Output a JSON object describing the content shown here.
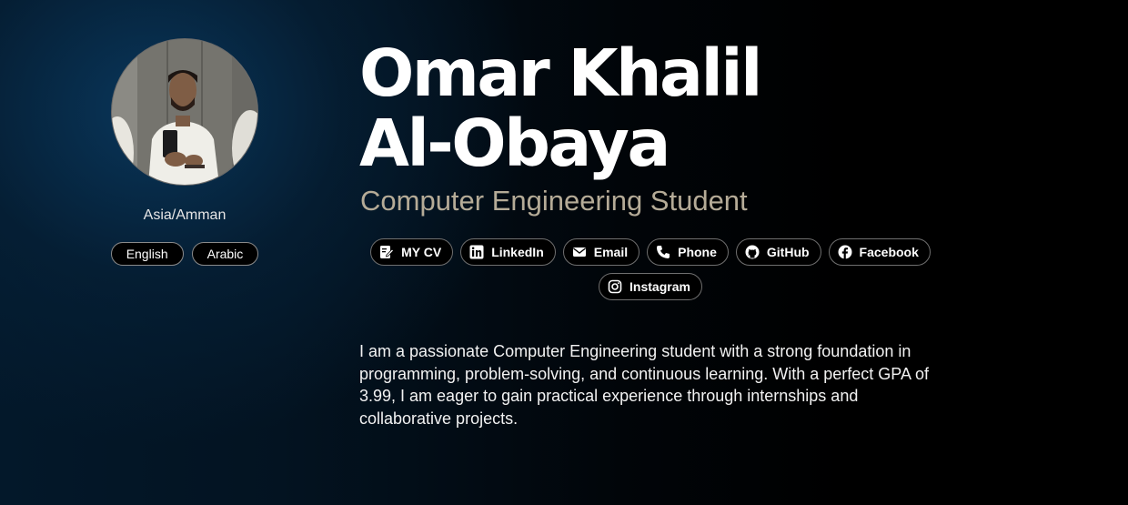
{
  "profile": {
    "name": "Omar Khalil Al-Obaya",
    "role": "Computer Engineering Student",
    "timezone": "Asia/Amman",
    "avatar_alt": "profile-photo"
  },
  "languages": [
    {
      "label": "English"
    },
    {
      "label": "Arabic"
    }
  ],
  "links": [
    {
      "label": "MY CV",
      "icon": "cv-icon"
    },
    {
      "label": "LinkedIn",
      "icon": "linkedin-icon"
    },
    {
      "label": "Email",
      "icon": "envelope-icon"
    },
    {
      "label": "Phone",
      "icon": "phone-icon"
    },
    {
      "label": "GitHub",
      "icon": "github-icon"
    },
    {
      "label": "Facebook",
      "icon": "facebook-icon"
    },
    {
      "label": "Instagram",
      "icon": "instagram-icon"
    }
  ],
  "bio": "I am a passionate Computer Engineering student with a strong foundation in programming, problem-solving, and continuous learning. With a perfect GPA of 3.99, I am eager to gain practical experience through internships and collaborative projects.",
  "colors": {
    "background_start": "#03182a",
    "background_end": "#000000",
    "role_text": "#b5ab97",
    "pill_border": "#6f6f6f"
  }
}
